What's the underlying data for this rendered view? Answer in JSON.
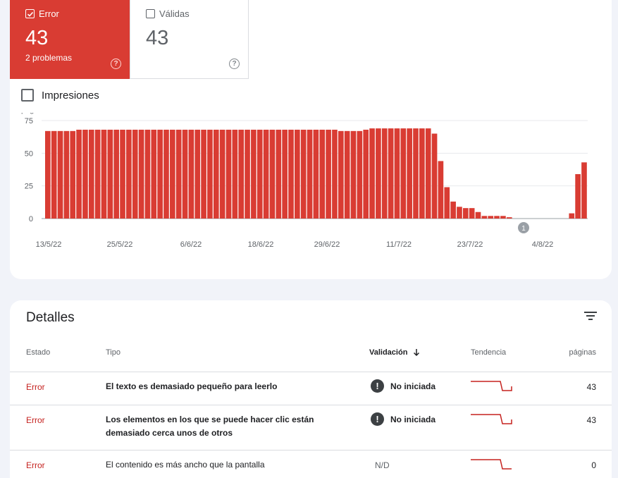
{
  "tiles": {
    "error": {
      "label": "Error",
      "value": "43",
      "subtitle": "2 problemas",
      "help": "?"
    },
    "valid": {
      "label": "Válidas",
      "value": "43",
      "help": "?"
    }
  },
  "impressions_label": "Impresiones",
  "chart_data": {
    "type": "bar",
    "ylabel": "páginas",
    "ylim": [
      0,
      75
    ],
    "yticks": [
      "75",
      "50",
      "25",
      "0"
    ],
    "xtick_labels": [
      "13/5/22",
      "25/5/22",
      "6/6/22",
      "18/6/22",
      "29/6/22",
      "11/7/22",
      "23/7/22",
      "4/8/22"
    ],
    "values": [
      67,
      67,
      67,
      67,
      67,
      68,
      68,
      68,
      68,
      68,
      68,
      68,
      68,
      68,
      68,
      68,
      68,
      68,
      68,
      68,
      68,
      68,
      68,
      68,
      68,
      68,
      68,
      68,
      68,
      68,
      68,
      68,
      68,
      68,
      68,
      68,
      68,
      68,
      68,
      68,
      68,
      68,
      68,
      68,
      68,
      68,
      68,
      67,
      67,
      67,
      67,
      68,
      69,
      69,
      69,
      69,
      69,
      69,
      69,
      69,
      69,
      69,
      65,
      44,
      24,
      13,
      9,
      8,
      8,
      5,
      2,
      2,
      2,
      2,
      1,
      0,
      0,
      0,
      0,
      0,
      0,
      0,
      0,
      0,
      4,
      34,
      43
    ],
    "annotation": {
      "label": "1"
    },
    "color": "#d93c33"
  },
  "details": {
    "title": "Detalles",
    "columns": {
      "estado": "Estado",
      "tipo": "Tipo",
      "validacion": "Validación",
      "tendencia": "Tendencia",
      "paginas": "páginas"
    },
    "rows": [
      {
        "estado": "Error",
        "tipo": "El texto es demasiado pequeño para leerlo",
        "validacion": "No iniciada",
        "paginas": "43"
      },
      {
        "estado": "Error",
        "tipo": "Los elementos en los que se puede hacer clic están demasiado cerca unos de otros",
        "validacion": "No iniciada",
        "paginas": "43"
      },
      {
        "estado": "Error",
        "tipo": "El contenido es más ancho que la pantalla",
        "validacion": "N/D",
        "paginas": "0"
      }
    ]
  },
  "colors": {
    "error": "#d93c33",
    "error_text": "#c5221f",
    "trend": "#c5221f"
  }
}
